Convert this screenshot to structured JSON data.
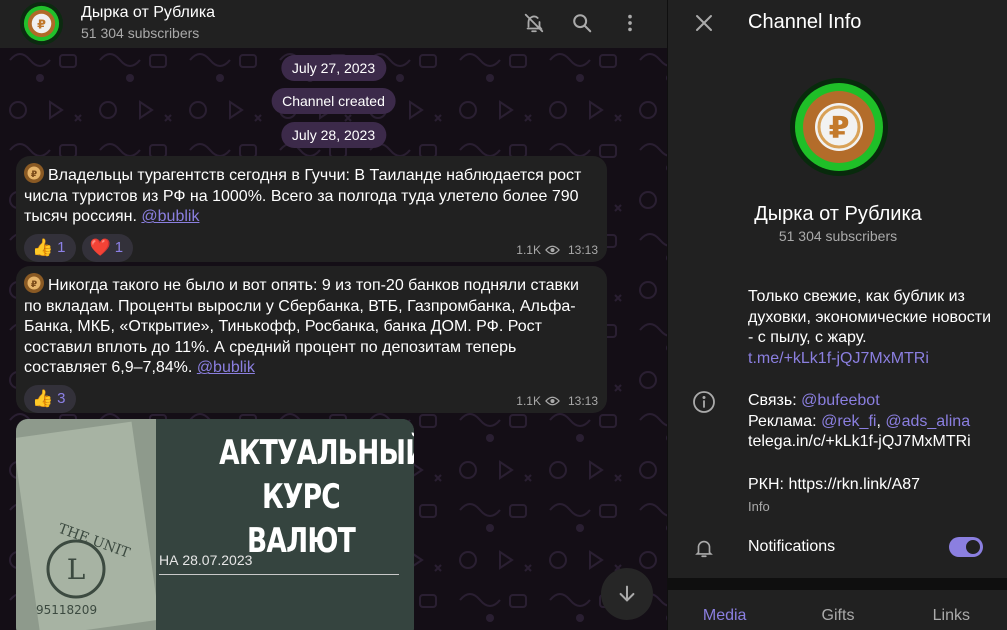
{
  "channel": {
    "name": "Дырка от Рублика",
    "subscribers": "51 304 subscribers",
    "avatar_symbol": "₽"
  },
  "header": {
    "icons": [
      "bell-muted-icon",
      "search-icon",
      "more-vertical-icon"
    ]
  },
  "chat": {
    "service": {
      "date1": "July 27, 2023",
      "created": "Channel created",
      "date2": "July 28, 2023"
    },
    "messages": [
      {
        "text": "Владельцы турагентств сегодня в Гуччи: В Таиланде наблюдается рост числа туристов из РФ на 1000%. Всего за полгода туда улетело более 790 тысяч россиян.",
        "mention": "@bublik",
        "reactions": [
          {
            "emoji": "👍",
            "count": "1"
          },
          {
            "emoji": "❤️",
            "count": "1"
          }
        ],
        "views": "1.1K",
        "time": "13:13"
      },
      {
        "text": "Никогда такого не было и вот опять: 9 из топ-20 банков подняли ставки по вкладам. Проценты выросли у Сбербанка, ВТБ, Газпромбанка, Альфа-Банка, МКБ,  «Открытие», Тинькофф, Росбанка, банка ДОМ. РФ. Рост составил вплоть до 11%. А средний процент по депозитам теперь составляет 6,9–7,84%.",
        "mention": "@bublik",
        "reactions": [
          {
            "emoji": "👍",
            "count": "3"
          }
        ],
        "views": "1.1K",
        "time": "13:13"
      }
    ],
    "image_post": {
      "line1": "АКТУАЛЬНЫЙ",
      "line2": "КУРС ВАЛЮТ",
      "date_caption": "НА 28.07.2023"
    }
  },
  "info": {
    "title": "Channel Info",
    "description": "Только свежие, как бублик из духовки, экономические новости - с пылу, с жару.",
    "invite_link": "t.me/+kLk1f-jQJ7MxMTRi",
    "contact_label": "Связь: ",
    "contact_user": "@bufeebot",
    "ads_label": "Реклама: ",
    "ads_user1": "@rek_fi",
    "ads_sep": ", ",
    "ads_user2": "@ads_alina",
    "telega_link": "telega.in/c/+kLk1f-jQJ7MxMTRi",
    "rkn": "РКН: https://rkn.link/A87",
    "info_label": "Info",
    "notifications_label": "Notifications",
    "notifications_on": true,
    "tabs": [
      "Media",
      "Gifts",
      "Links"
    ]
  },
  "colors": {
    "accent": "#8b7fe0",
    "panel": "#212121",
    "chat_bg": "#140e16",
    "date_pill": "#3c2a4a"
  }
}
